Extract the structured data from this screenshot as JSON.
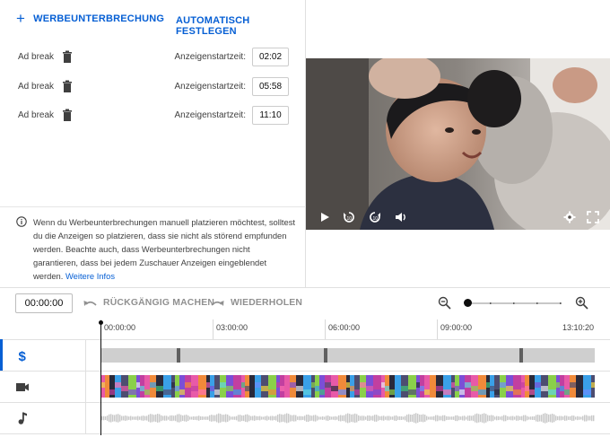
{
  "ad_panel": {
    "add_label": "WERBEUNTERBRECHUNG",
    "auto_label": "AUTOMATISCH FESTLEGEN",
    "breaks": [
      {
        "label": "Ad break",
        "start_label": "Anzeigenstartzeit:",
        "time": "02:02"
      },
      {
        "label": "Ad break",
        "start_label": "Anzeigenstartzeit:",
        "time": "05:58"
      },
      {
        "label": "Ad break",
        "start_label": "Anzeigenstartzeit:",
        "time": "11:10"
      }
    ],
    "info_text": "Wenn du Werbeunterbrechungen manuell platzieren möchtest, solltest du die Anzeigen so platzieren, dass sie nicht als störend empfunden werden. Beachte auch, dass Werbeunterbrechungen nicht garantieren, dass bei jedem Zuschauer Anzeigen eingeblendet werden. ",
    "info_link": "Weitere Infos"
  },
  "timeline": {
    "timecode": "00:00:00",
    "undo_label": "RÜCKGÄNGIG MACHEN",
    "redo_label": "WIEDERHOLEN",
    "zoom_level": 0,
    "ruler": [
      "00:00:00",
      "03:00:00",
      "06:00:00",
      "09:00:00",
      "13:10:20"
    ],
    "tracks": [
      "ad-breaks",
      "video",
      "audio"
    ],
    "icons": {
      "ad_track": "dollar-icon",
      "video_track": "camera-icon",
      "audio_track": "music-note-icon"
    },
    "accent_color": "#065fd4"
  },
  "player": {
    "icons": [
      "play-icon",
      "rewind-10-icon",
      "forward-10-icon",
      "volume-icon",
      "settings-icon",
      "fullscreen-icon"
    ]
  }
}
